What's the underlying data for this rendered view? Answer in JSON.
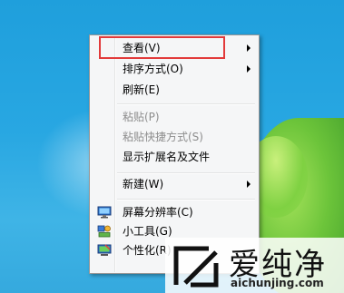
{
  "context_menu": {
    "items": [
      {
        "label": "查看(V)",
        "submenu": true,
        "enabled": true,
        "highlighted": true
      },
      {
        "label": "排序方式(O)",
        "submenu": true,
        "enabled": true
      },
      {
        "label": "刷新(E)",
        "enabled": true
      },
      {
        "label": "粘贴(P)",
        "enabled": false
      },
      {
        "label": "粘贴快捷方式(S)",
        "enabled": false
      },
      {
        "label": "显示扩展名及文件",
        "enabled": true
      },
      {
        "label": "新建(W)",
        "submenu": true,
        "enabled": true
      },
      {
        "label": "屏幕分辨率(C)",
        "icon": "screen-resolution-icon",
        "enabled": true
      },
      {
        "label": "小工具(G)",
        "icon": "gadgets-icon",
        "enabled": true
      },
      {
        "label": "个性化(R)",
        "icon": "personalize-icon",
        "enabled": true
      }
    ]
  },
  "watermark": {
    "text": "爱纯净",
    "url": "aichunjing.com"
  },
  "colors": {
    "highlight_box": "#e23a3a",
    "desktop": "#28a7e2",
    "menu_background": "#f5f6f7"
  }
}
